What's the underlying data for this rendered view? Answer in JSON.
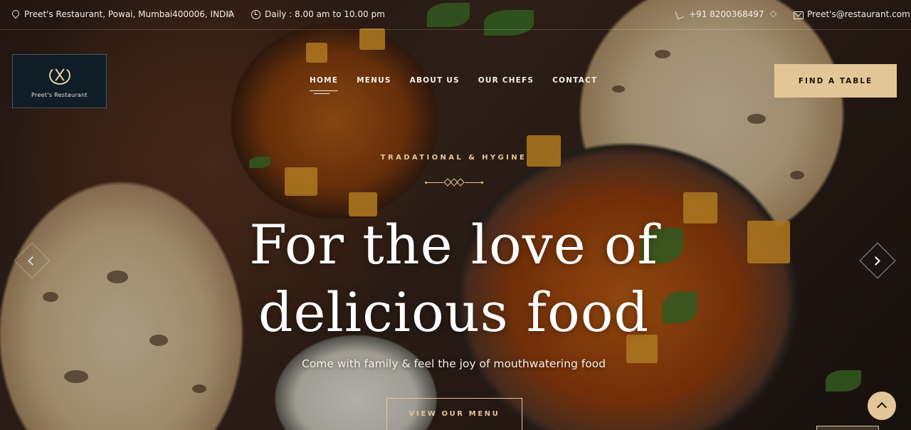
{
  "topbar": {
    "address": "Preet's Restaurant, Powai, Mumbai400006, INDIA",
    "hours": "Daily : 8.00 am to 10.00 pm",
    "phone": "+91 8200368497",
    "email": "Preet's@restaurant.com",
    "icons": [
      "location-pin-icon",
      "clock-icon",
      "phone-icon",
      "mail-icon"
    ]
  },
  "logo": {
    "text": "Preet's Restaurant"
  },
  "nav": {
    "items": [
      "HOME",
      "MENUS",
      "ABOUT US",
      "OUR CHEFS",
      "CONTACT"
    ],
    "active": "HOME"
  },
  "find_table": {
    "label": "FIND A TABLE"
  },
  "hero": {
    "subtitle": "TRADATIONAL & HYGINE",
    "headline_line1": "For the love of",
    "headline_line2": "delicious food",
    "tagline": "Come with family & feel the joy of mouthwatering food",
    "cta": "VIEW OUR MENU"
  },
  "colors": {
    "accent": "#e3c698",
    "logo_bg": "#0f1d26",
    "text": "#ffffff"
  }
}
